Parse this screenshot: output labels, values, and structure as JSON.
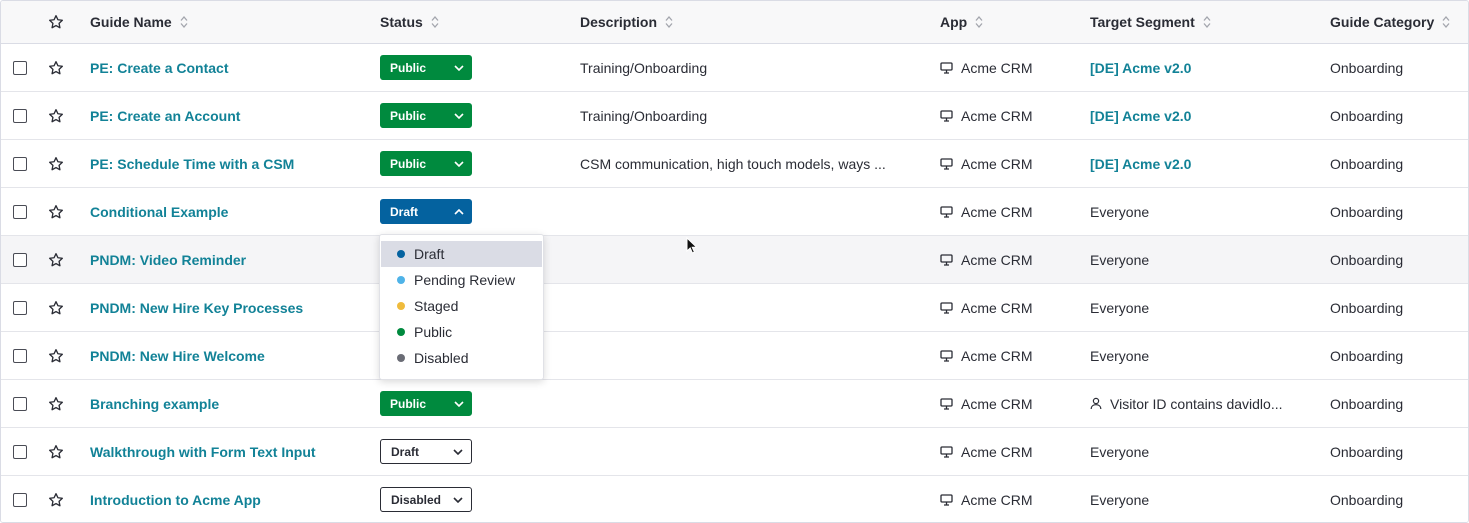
{
  "columns": {
    "guide_name": "Guide Name",
    "status": "Status",
    "description": "Description",
    "app": "App",
    "target_segment": "Target Segment",
    "guide_category": "Guide Category"
  },
  "rows": [
    {
      "name": "PE: Create a Contact",
      "status": "Public",
      "description": "Training/Onboarding",
      "app": "Acme CRM",
      "segment": "[DE] Acme v2.0",
      "category": "Onboarding"
    },
    {
      "name": "PE: Create an Account",
      "status": "Public",
      "description": "Training/Onboarding",
      "app": "Acme CRM",
      "segment": "[DE] Acme v2.0",
      "category": "Onboarding"
    },
    {
      "name": "PE: Schedule Time with a CSM",
      "status": "Public",
      "description": "CSM communication, high touch models, ways ...",
      "app": "Acme CRM",
      "segment": "[DE] Acme v2.0",
      "category": "Onboarding"
    },
    {
      "name": "Conditional Example",
      "status": "Draft",
      "description": "",
      "app": "Acme CRM",
      "segment": "Everyone",
      "category": "Onboarding"
    },
    {
      "name": "PNDM: Video Reminder",
      "status": "",
      "description": "",
      "app": "Acme CRM",
      "segment": "Everyone",
      "category": "Onboarding"
    },
    {
      "name": "PNDM: New Hire Key Processes",
      "status": "",
      "description": "",
      "app": "Acme CRM",
      "segment": "Everyone",
      "category": "Onboarding"
    },
    {
      "name": "PNDM: New Hire Welcome",
      "status": "",
      "description": "",
      "app": "Acme CRM",
      "segment": "Everyone",
      "category": "Onboarding"
    },
    {
      "name": "Branching example",
      "status": "Public",
      "description": "",
      "app": "Acme CRM",
      "segment": "Visitor ID contains davidlo...",
      "category": "Onboarding"
    },
    {
      "name": "Walkthrough with Form Text Input",
      "status": "Draft",
      "description": "",
      "app": "Acme CRM",
      "segment": "Everyone",
      "category": "Onboarding"
    },
    {
      "name": "Introduction to Acme App",
      "status": "Disabled",
      "description": "",
      "app": "Acme CRM",
      "segment": "Everyone",
      "category": "Onboarding"
    }
  ],
  "status_dropdown": {
    "options": [
      {
        "label": "Draft",
        "color": "#04629f"
      },
      {
        "label": "Pending Review",
        "color": "#4fb3e8"
      },
      {
        "label": "Staged",
        "color": "#efbb3c"
      },
      {
        "label": "Public",
        "color": "#008a3e"
      },
      {
        "label": "Disabled",
        "color": "#6a6c75"
      }
    ],
    "selected": "Draft"
  },
  "colors": {
    "link": "#128297",
    "public": "#008a3e",
    "draft_active": "#04629f"
  }
}
